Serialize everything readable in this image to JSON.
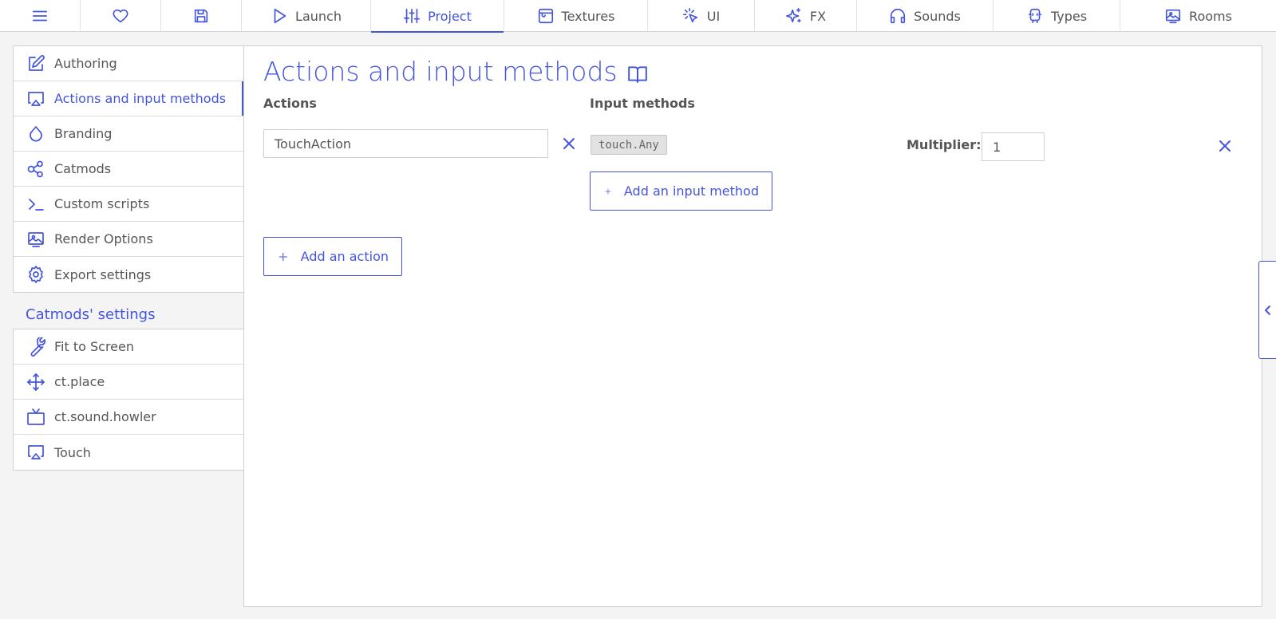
{
  "topnav": {
    "tabs": [
      {
        "label": "",
        "icon": "menu-icon"
      },
      {
        "label": "",
        "icon": "heart-icon"
      },
      {
        "label": "",
        "icon": "save-icon"
      },
      {
        "label": "Launch",
        "icon": "play-icon"
      },
      {
        "label": "Project",
        "icon": "sliders-icon",
        "active": true
      },
      {
        "label": "Textures",
        "icon": "texture-icon"
      },
      {
        "label": "UI",
        "icon": "cursor-click-icon"
      },
      {
        "label": "FX",
        "icon": "sparkles-icon"
      },
      {
        "label": "Sounds",
        "icon": "headphones-icon"
      },
      {
        "label": "Types",
        "icon": "type-icon"
      },
      {
        "label": "Rooms",
        "icon": "room-icon"
      }
    ]
  },
  "sidebar": {
    "items": [
      {
        "label": "Authoring",
        "icon": "edit-icon"
      },
      {
        "label": "Actions and input methods",
        "icon": "airplay-icon",
        "active": true
      },
      {
        "label": "Branding",
        "icon": "droplet-icon"
      },
      {
        "label": "Catmods",
        "icon": "share-icon"
      },
      {
        "label": "Custom scripts",
        "icon": "terminal-icon"
      },
      {
        "label": "Render Options",
        "icon": "image-icon"
      },
      {
        "label": "Export settings",
        "icon": "gear-icon"
      }
    ],
    "catmods_heading": "Catmods' settings",
    "catmods": [
      {
        "label": "Fit to Screen",
        "icon": "wrench-icon"
      },
      {
        "label": "ct.place",
        "icon": "move-icon"
      },
      {
        "label": "ct.sound.howler",
        "icon": "tv-icon"
      },
      {
        "label": "Touch",
        "icon": "airplay-icon"
      }
    ]
  },
  "main": {
    "title": "Actions and input methods",
    "actions_header": "Actions",
    "input_methods_header": "Input methods",
    "action_name_value": "TouchAction",
    "input_method_code": "touch.Any",
    "multiplier_label": "Multiplier:",
    "multiplier_value": "1",
    "add_input_method_label": "Add an input method",
    "add_action_label": "Add an action"
  },
  "colors": {
    "accent": "#4455dd",
    "background": "#f4f4f4",
    "panel": "#ffffff",
    "text": "#555555"
  }
}
